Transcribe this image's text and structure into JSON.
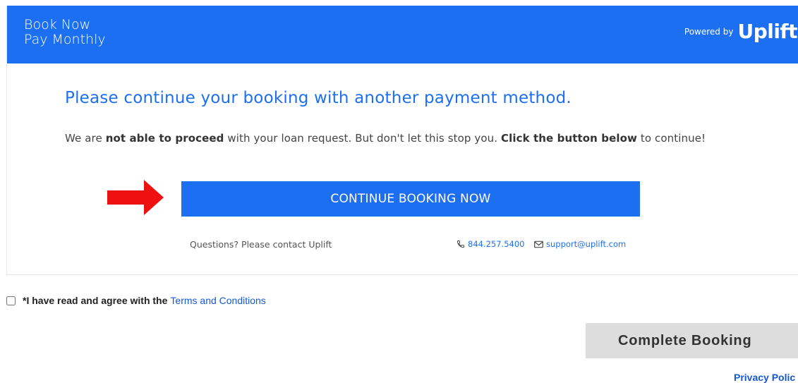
{
  "header": {
    "tagline_line1": "Book Now",
    "tagline_line2": "Pay Monthly",
    "powered_by_label": "Powered by",
    "logo_text": "Uplift"
  },
  "content": {
    "headline": "Please continue your booking with another payment method.",
    "message_part1": "We are ",
    "message_bold1": "not able to proceed",
    "message_part2": " with your loan request. But don't let this stop you. ",
    "message_bold2": "Click the button below",
    "message_part3": " to continue!",
    "continue_button_label": "CONTINUE BOOKING NOW"
  },
  "contact": {
    "text": "Questions? Please contact Uplift",
    "phone": "844.257.5400",
    "email": "support@uplift.com"
  },
  "terms": {
    "label": "*I have read and agree with the",
    "link_text": "Terms and Conditions",
    "checked": false
  },
  "footer": {
    "complete_button_label": "Complete Booking",
    "privacy_link": "Privacy Polic"
  },
  "colors": {
    "brand_blue": "#1d6ff2",
    "arrow_red": "#ee1111",
    "button_gray": "#dddddd",
    "link_blue": "#1558d6"
  },
  "icons": [
    "phone-icon",
    "mail-icon",
    "red-arrow-icon"
  ]
}
